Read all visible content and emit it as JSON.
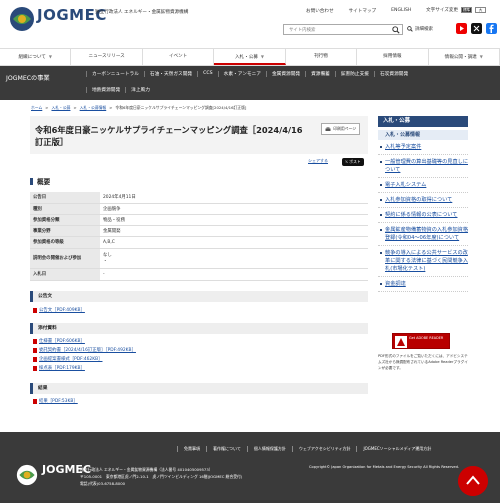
{
  "header": {
    "logo_text": "JOGMEC",
    "org_sub": "独立行政法人 エネルギー・金属鉱物資源機構",
    "top_links": [
      "お問い合わせ",
      "サイトマップ",
      "ENGLISH"
    ],
    "font_size_label": "文字サイズ変更",
    "font_sizes": [
      "標準",
      "大"
    ],
    "search_placeholder": "サイト内検索",
    "advanced_search": "詳細検索"
  },
  "main_nav": [
    "組織について",
    "ニュースリリース",
    "イベント",
    "入札・公募",
    "刊行物",
    "採用情報",
    "情報公開・調達"
  ],
  "section_nav": {
    "title": "JOGMECの事業",
    "row1": [
      "カーボンニュートラル",
      "石油・天然ガス開発",
      "CCS",
      "水素・アンモニア",
      "金属資源開発",
      "資源備蓄",
      "鉱害防止支援",
      "石炭資源開発"
    ],
    "row2": [
      "地熱資源開発",
      "洋上風力"
    ]
  },
  "breadcrumb": [
    "ホーム",
    "入札・公募",
    "入札・公募情報",
    "令和6年度日豪ニッケルサプライチェーンマッピング調査[2024/4/16訂正版]"
  ],
  "page": {
    "title": "令和6年度日豪ニッケルサプライチェーンマッピング調査［2024/4/16訂正版］",
    "print_label": "印刷用ページ",
    "share_label": "シェアする",
    "post_label": "ポスト"
  },
  "overview": {
    "heading": "概要",
    "rows": [
      {
        "k": "公告日",
        "v": "2024年4月11日"
      },
      {
        "k": "種別",
        "v": "企画競争"
      },
      {
        "k": "参加資格分類",
        "v": "物品・役務"
      },
      {
        "k": "事業分野",
        "v": "金属開発"
      },
      {
        "k": "参加資格の等級",
        "v": "A,B,C"
      },
      {
        "k": "説明会の開催および参加",
        "v": "なし"
      },
      {
        "k": "入札日",
        "v": "-"
      }
    ]
  },
  "sections": [
    {
      "title": "公告文",
      "files": [
        "公告文［PDF:409KB］"
      ]
    },
    {
      "title": "添付資料",
      "files": [
        "仕様書［PDF:606KB］",
        "委託契約書［2024/4/16訂正版］［PDF:492KB］",
        "企画提案書様式［PDF:462KB］",
        "採点表［PDF:179KB］"
      ]
    },
    {
      "title": "結果",
      "files": [
        "結果［PDF:53KB］"
      ]
    }
  ],
  "sidebar": {
    "heading": "入札・公募",
    "sub": "入札・公募情報",
    "items": [
      "入札等予定案件",
      "一般管理費の算出基礎等の見直しについて",
      "電子入札システム",
      "入札参加資格の取得について",
      "契約に係る情報の公表について",
      "金属鉱産物備蓄物資の入札参加資格登録(令和04〜06年度)について",
      "競争の導入による公共サービスの改革に関する法律に基づく民間競争入札(市場化テスト)",
      "資金調達"
    ],
    "reader_badge": "Get ADOBE READER",
    "reader_note": "PDF形式のファイルをご覧いただくには、アドビシステムズ社から無償配布されているAdobe Readerプラグインが必要です。"
  },
  "footer": {
    "links": [
      "免責事項",
      "著作権について",
      "個人情報保護方針",
      "ウェブアクセシビリティ方針",
      "JOGMECソーシャルメディア運用方針"
    ],
    "logo_text": "JOGMEC",
    "address1": "独立行政法人 エネルギー・金属鉱物資源機構（法人番号 4010405009573）",
    "address2": "〒105-0001　東京都港区虎ノ門2-10-1　虎ノ門ツインビルディング 16階(JOGMEC 総合受付)",
    "address3": "電話(代表)03-6758-8000",
    "copyright": "Copyright© Japan Organization for Metals and Energy Security All Rights Reserved."
  },
  "colors": {
    "brand": "#2a4a7a",
    "accent": "#cc0000",
    "dark": "#3a3a3a"
  }
}
